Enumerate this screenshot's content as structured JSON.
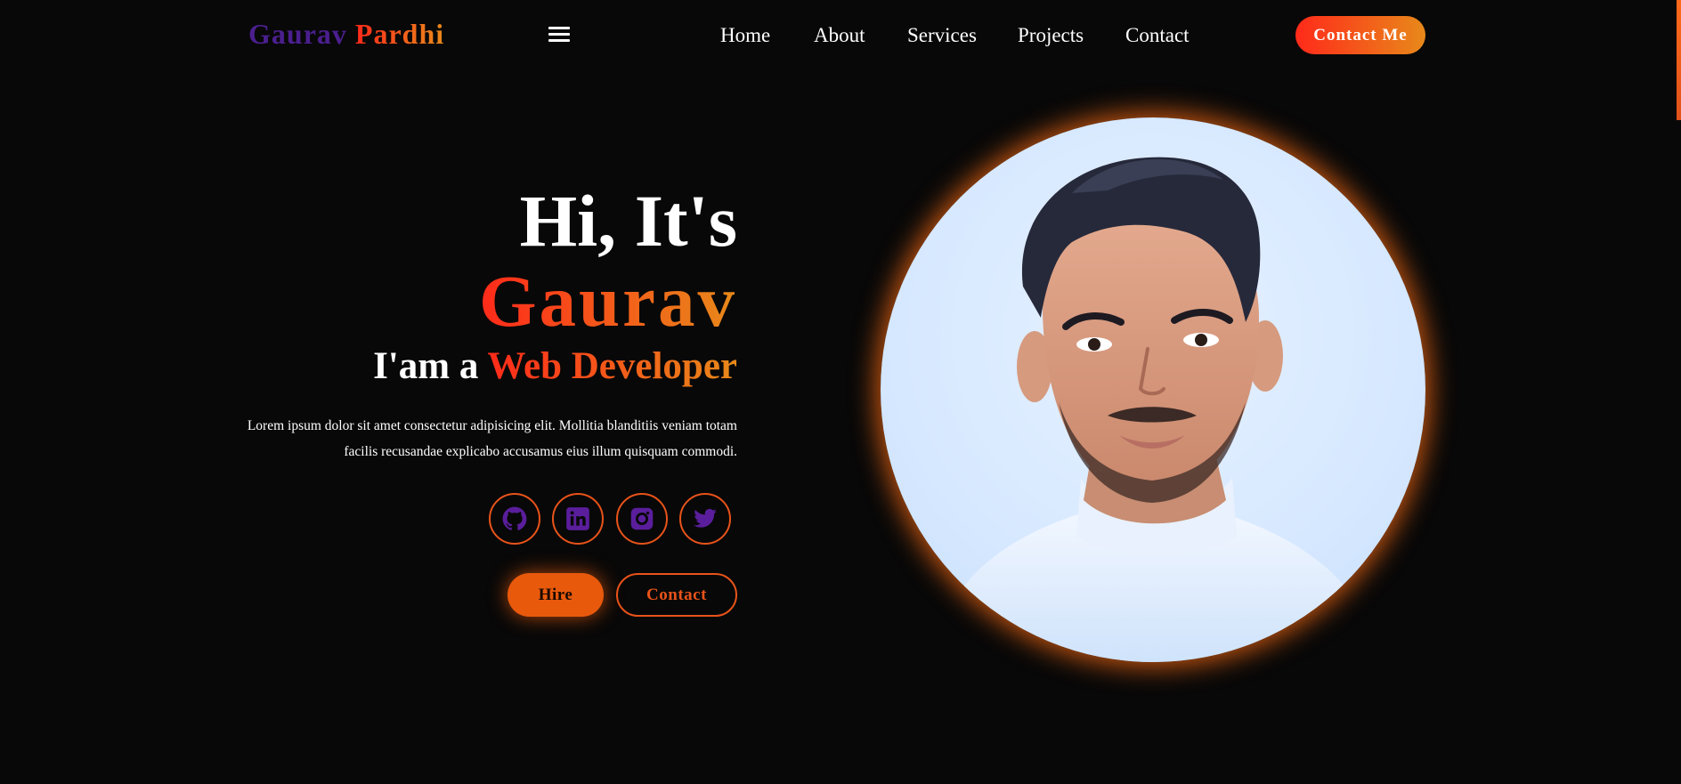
{
  "header": {
    "logo": {
      "first": "Gaurav",
      "last": "Pardhi"
    },
    "nav": [
      {
        "label": "Home"
      },
      {
        "label": "About"
      },
      {
        "label": "Services"
      },
      {
        "label": "Projects"
      },
      {
        "label": "Contact"
      }
    ],
    "cta_label": "Contact Me"
  },
  "hero": {
    "greeting": "Hi, It's",
    "name": "Gaurav",
    "role_prefix": "I'am a",
    "role": "Web Developer",
    "description": "Lorem ipsum dolor sit amet consectetur adipisicing elit. Mollitia blanditiis veniam totam facilis recusandae explicabo accusamus eius illum quisquam commodi.",
    "social_icons": [
      "github-icon",
      "linkedin-icon",
      "instagram-icon",
      "twitter-icon"
    ],
    "hire_label": "Hire",
    "contact_label": "Contact"
  },
  "colors": {
    "background": "#080808",
    "accent_start": "#ff2a1a",
    "accent_end": "#e8891a",
    "logo_purple": "#4b1f8f",
    "icon_purple": "#5a1e9c",
    "orange": "#e8531a"
  }
}
